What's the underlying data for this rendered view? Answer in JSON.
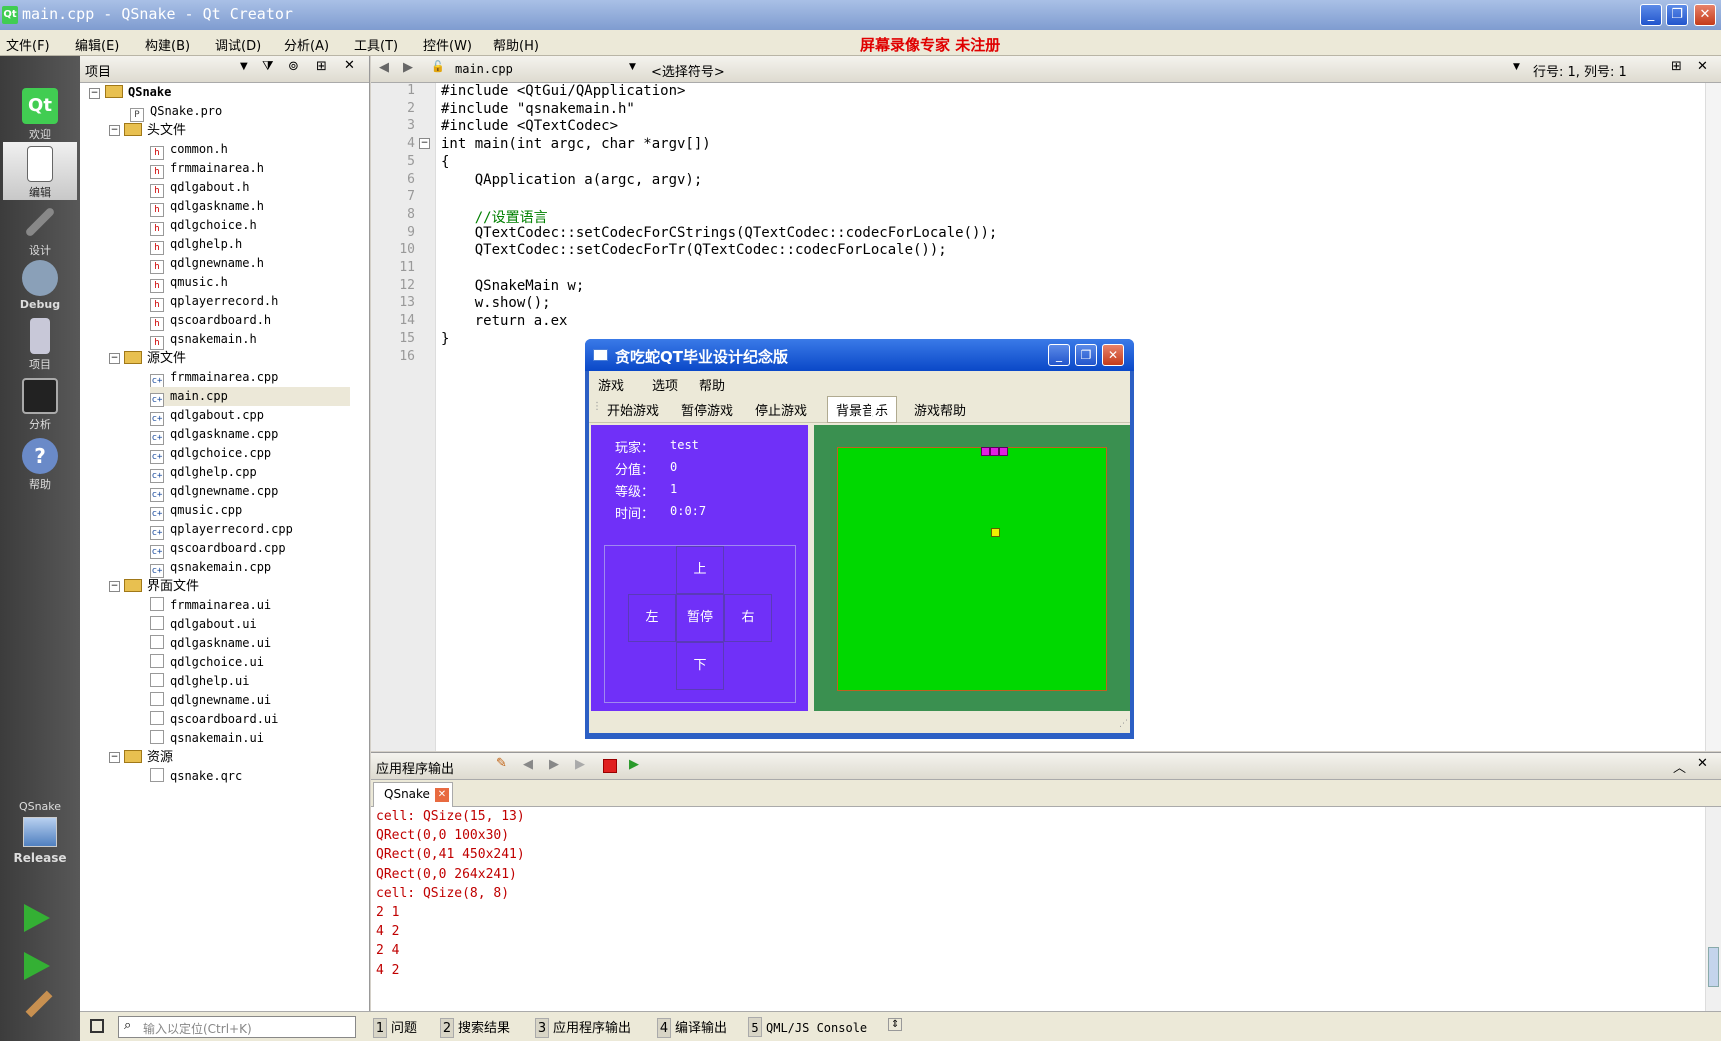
{
  "window": {
    "title": "main.cpp - QSnake - Qt Creator",
    "buttons": {
      "minimize": "_",
      "restore": "❐",
      "close": "✕"
    }
  },
  "menubar": {
    "items": [
      "文件(F)",
      "编辑(E)",
      "构建(B)",
      "调试(D)",
      "分析(A)",
      "工具(T)",
      "控件(W)",
      "帮助(H)"
    ],
    "watermark": "屏幕录像专家  未注册"
  },
  "modes": [
    {
      "label": "欢迎",
      "icon": "qt-welcome-icon"
    },
    {
      "label": "编辑",
      "icon": "edit-icon"
    },
    {
      "label": "设计",
      "icon": "design-icon"
    },
    {
      "label": "Debug",
      "icon": "debug-icon"
    },
    {
      "label": "项目",
      "icon": "projects-icon"
    },
    {
      "label": "分析",
      "icon": "analyze-icon"
    },
    {
      "label": "帮助",
      "icon": "help-icon"
    }
  ],
  "target": {
    "project": "QSnake",
    "config": "Release"
  },
  "project_pane": {
    "title": "项目",
    "root": "QSnake",
    "pro": "QSnake.pro",
    "groups": [
      {
        "name": "头文件",
        "files": [
          "common.h",
          "frmmainarea.h",
          "qdlgabout.h",
          "qdlgaskname.h",
          "qdlgchoice.h",
          "qdlghelp.h",
          "qdlgnewname.h",
          "qmusic.h",
          "qplayerrecord.h",
          "qscoardboard.h",
          "qsnakemain.h"
        ]
      },
      {
        "name": "源文件",
        "files": [
          "frmmainarea.cpp",
          "main.cpp",
          "qdlgabout.cpp",
          "qdlgaskname.cpp",
          "qdlgchoice.cpp",
          "qdlghelp.cpp",
          "qdlgnewname.cpp",
          "qmusic.cpp",
          "qplayerrecord.cpp",
          "qscoardboard.cpp",
          "qsnakemain.cpp"
        ]
      },
      {
        "name": "界面文件",
        "files": [
          "frmmainarea.ui",
          "qdlgabout.ui",
          "qdlgaskname.ui",
          "qdlgchoice.ui",
          "qdlghelp.ui",
          "qdlgnewname.ui",
          "qscoardboard.ui",
          "qsnakemain.ui"
        ]
      },
      {
        "name": "资源",
        "files": [
          "qsnake.qrc"
        ]
      }
    ],
    "selected": "main.cpp"
  },
  "editor": {
    "file": "main.cpp",
    "symbol": "<选择符号>",
    "position": "行号: 1, 列号: 1",
    "lines": [
      "#include <QtGui/QApplication>",
      "#include \"qsnakemain.h\"",
      "#include <QTextCodec>",
      "int main(int argc, char *argv[])",
      "{",
      "    QApplication a(argc, argv);",
      "",
      "    //设置语言",
      "    QTextCodec::setCodecForCStrings(QTextCodec::codecForLocale());",
      "    QTextCodec::setCodecForTr(QTextCodec::codecForLocale());",
      "",
      "    QSnakeMain w;",
      "    w.show();",
      "    return a.ex",
      "}",
      ""
    ]
  },
  "output_pane": {
    "title": "应用程序输出",
    "tab": "QSnake",
    "lines": [
      "cell: QSize(15, 13)",
      "QRect(0,0 100x30)",
      "QRect(0,41 450x241)",
      "QRect(0,0 264x241)",
      "cell: QSize(8, 8)",
      "2 1",
      "4 2",
      "2 4",
      "4 2"
    ]
  },
  "statusbar": {
    "locator_placeholder": "输入以定位(Ctrl+K)",
    "tabs": [
      {
        "n": "1",
        "label": "问题"
      },
      {
        "n": "2",
        "label": "搜索结果"
      },
      {
        "n": "3",
        "label": "应用程序输出"
      },
      {
        "n": "4",
        "label": "编译输出"
      },
      {
        "n": "5",
        "label": "QML/JS Console"
      }
    ]
  },
  "snake_window": {
    "title": "贪吃蛇QT毕业设计纪念版",
    "menu": [
      "游戏",
      "选项",
      "帮助"
    ],
    "toolbar": [
      "开始游戏",
      "暂停游戏",
      "停止游戏",
      "背景音乐",
      "游戏帮助"
    ],
    "info": [
      {
        "label": "玩家：",
        "value": "test"
      },
      {
        "label": "分值：",
        "value": "0"
      },
      {
        "label": "等级：",
        "value": "1"
      },
      {
        "label": "时间：",
        "value": "0:0:7"
      }
    ],
    "pad": {
      "up": "上",
      "down": "下",
      "left": "左",
      "right": "右",
      "pause": "暂停"
    },
    "colors": {
      "left_panel": "#7030f8",
      "field": "#00d800",
      "snake": "#e020e0",
      "food": "#f0f000"
    }
  }
}
